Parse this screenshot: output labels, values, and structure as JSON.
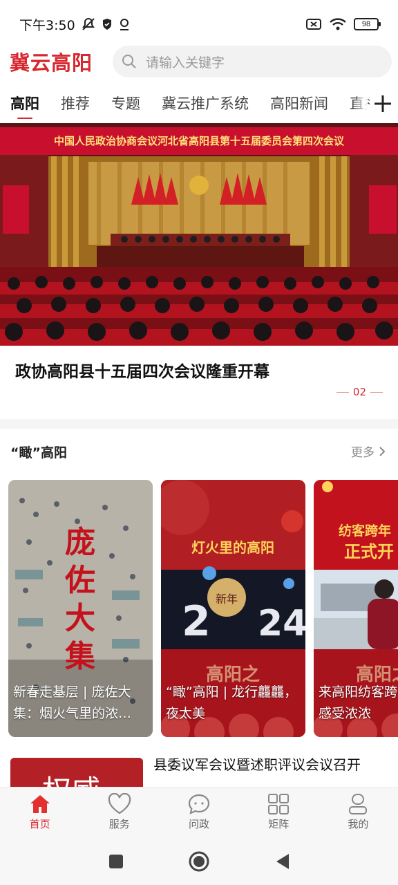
{
  "status_bar": {
    "time": "下午3:50",
    "battery": "98"
  },
  "header": {
    "brand": "冀云高阳",
    "search_placeholder": "请输入关键字"
  },
  "tabs": [
    "高阳",
    "推荐",
    "专题",
    "冀云推广系统",
    "高阳新闻",
    "直播"
  ],
  "banner": {
    "sign_text": "中国人民政治协商会议河北省高阳县第十五届委员会第四次会议",
    "caption": "政协高阳县十五届四次会议隆重开幕",
    "page_indicator": "02"
  },
  "section": {
    "title": "“瞰”高阳",
    "more_label": "更多"
  },
  "cards": [
    {
      "overlay_art": "庞佐大集",
      "caption": "新春走基层 | 庞佐大集：烟火气里的浓…"
    },
    {
      "overlay_art": "灯火里的高阳",
      "caption": "“瞰”高阳 | 龙行龘龘，夜太美"
    },
    {
      "overlay_art": "纺客跨年 正式开",
      "caption": "来高阳纺客跨年，集，感受浓浓"
    }
  ],
  "news": {
    "title": "县委议军会议暨述职评议会议召开",
    "thumb_text": "权威"
  },
  "bottom_nav": [
    {
      "label": "首页",
      "icon": "home-icon"
    },
    {
      "label": "服务",
      "icon": "heart-icon"
    },
    {
      "label": "问政",
      "icon": "chat-icon"
    },
    {
      "label": "矩阵",
      "icon": "grid-icon"
    },
    {
      "label": "我的",
      "icon": "user-icon"
    }
  ],
  "colors": {
    "accent": "#d7282f",
    "banner_red": "#c8102e"
  }
}
